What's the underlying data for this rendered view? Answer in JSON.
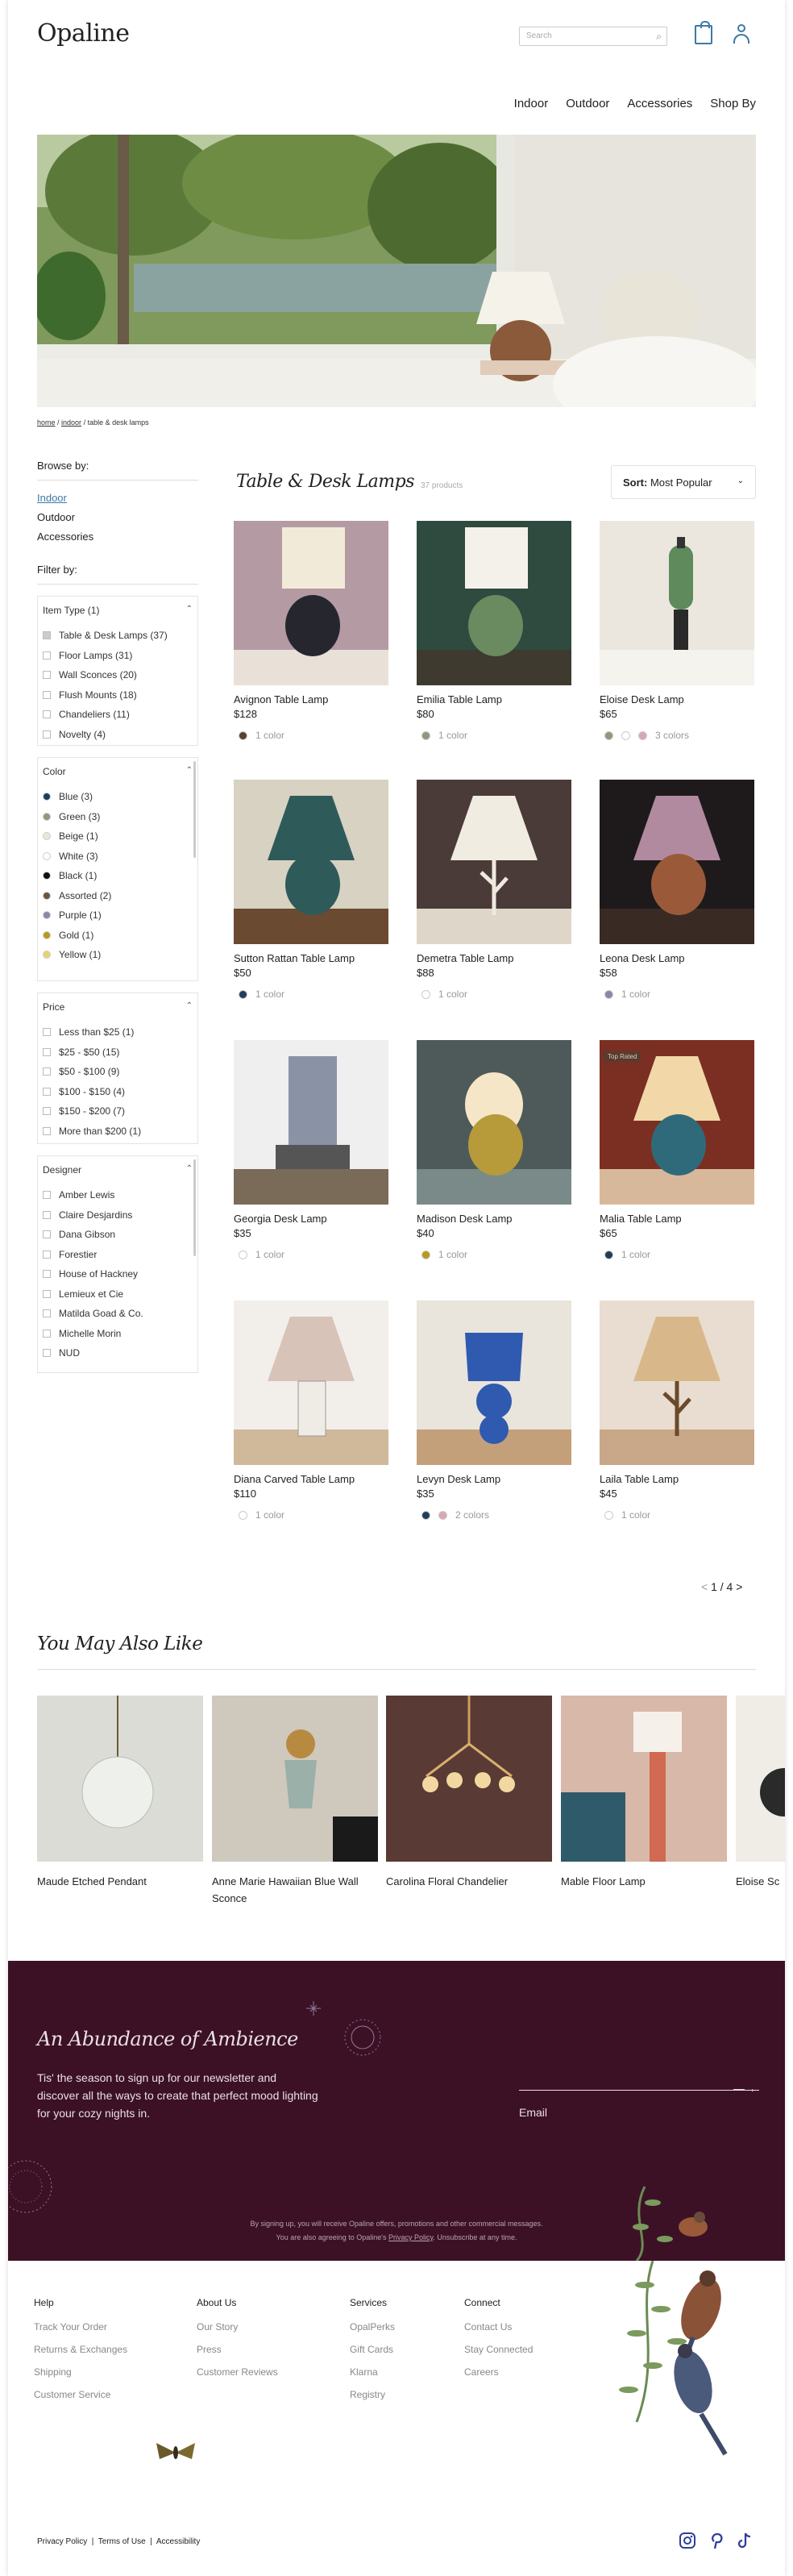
{
  "header": {
    "logo": "Opaline",
    "search_placeholder": "Search",
    "nav": [
      "Indoor",
      "Outdoor",
      "Accessories",
      "Shop By"
    ]
  },
  "breadcrumb": {
    "home": "home",
    "indoor": "indoor",
    "current": "table & desk lamps"
  },
  "sidebar": {
    "browse_heading": "Browse by:",
    "browse": [
      "Indoor",
      "Outdoor",
      "Accessories"
    ],
    "filter_heading": "Filter by:",
    "item_type": {
      "title": "Item Type (1)",
      "options": [
        "Table & Desk Lamps (37)",
        "Floor Lamps (31)",
        "Wall Sconces (20)",
        "Flush Mounts (18)",
        "Chandeliers (11)",
        "Novelty (4)"
      ]
    },
    "color": {
      "title": "Color",
      "options": [
        {
          "label": "Blue (3)",
          "color": "#1f3e5a"
        },
        {
          "label": "Green (3)",
          "color": "#8a9a7a"
        },
        {
          "label": "Beige (1)",
          "color": "#ece6d8"
        },
        {
          "label": "White (3)",
          "color": "#ffffff"
        },
        {
          "label": "Black (1)",
          "color": "#111111"
        },
        {
          "label": "Assorted (2)",
          "color": "#6b5440"
        },
        {
          "label": "Purple (1)",
          "color": "#8e86a8"
        },
        {
          "label": "Gold (1)",
          "color": "#b79a1a"
        },
        {
          "label": "Yellow (1)",
          "color": "#e7d36a"
        }
      ]
    },
    "price": {
      "title": "Price",
      "options": [
        "Less than $25 (1)",
        "$25 - $50 (15)",
        "$50 - $100 (9)",
        "$100 - $150 (4)",
        "$150 - $200 (7)",
        "More than $200 (1)"
      ]
    },
    "designer": {
      "title": "Designer",
      "options": [
        "Amber Lewis",
        "Claire Desjardins",
        "Dana Gibson",
        "Forestier",
        "House of Hackney",
        "Lemieux et Cie",
        "Matilda Goad & Co.",
        "Michelle Morin",
        "NUD"
      ]
    }
  },
  "catalog": {
    "title": "Table & Desk Lamps",
    "count": "37 products",
    "sort_label": "Sort:",
    "sort_value": "Most Popular",
    "pager": "1 / 4",
    "products": [
      {
        "name": "Avignon Table Lamp",
        "price": "$128",
        "colors_label": "1 color",
        "swatches": [
          "#5a4030"
        ]
      },
      {
        "name": "Emilia Table Lamp",
        "price": "$80",
        "colors_label": "1 color",
        "swatches": [
          "#8a9a7a"
        ]
      },
      {
        "name": "Eloise Desk Lamp",
        "price": "$65",
        "colors_label": "3 colors",
        "swatches": [
          "#8a9a7a",
          "#ffffff",
          "#d8a8b0"
        ]
      },
      {
        "name": "Sutton Rattan Table Lamp",
        "price": "$50",
        "colors_label": "1 color",
        "swatches": [
          "#1f3e5a"
        ]
      },
      {
        "name": "Demetra Table Lamp",
        "price": "$88",
        "colors_label": "1 color",
        "swatches": [
          "#ffffff"
        ]
      },
      {
        "name": "Leona Desk Lamp",
        "price": "$58",
        "colors_label": "1 color",
        "swatches": [
          "#8e86a8"
        ]
      },
      {
        "name": "Georgia Desk Lamp",
        "price": "$35",
        "colors_label": "1 color",
        "swatches": [
          "#ffffff"
        ]
      },
      {
        "name": "Madison Desk Lamp",
        "price": "$40",
        "colors_label": "1 color",
        "swatches": [
          "#b79a1a"
        ]
      },
      {
        "name": "Malia Table Lamp",
        "price": "$65",
        "colors_label": "1 color",
        "swatches": [
          "#1f3e5a"
        ],
        "badge": "Top Rated"
      },
      {
        "name": "Diana Carved Table Lamp",
        "price": "$110",
        "colors_label": "1 color",
        "swatches": [
          "#ffffff"
        ]
      },
      {
        "name": "Levyn Desk Lamp",
        "price": "$35",
        "colors_label": "2 colors",
        "swatches": [
          "#1f3e5a",
          "#d8a8b0"
        ]
      },
      {
        "name": "Laila Table Lamp",
        "price": "$45",
        "colors_label": "1 color",
        "swatches": [
          "#ffffff"
        ]
      }
    ]
  },
  "recommend": {
    "title": "You May Also Like",
    "items": [
      "Maude Etched Pendant",
      "Anne Marie Hawaiian Blue Wall Sconce",
      "Carolina Floral Chandelier",
      "Mable Floor Lamp",
      "Eloise Sc"
    ]
  },
  "newsletter": {
    "title": "An Abundance of Ambience",
    "body": "Tis' the season to sign up for our newsletter and discover all the ways to create that perfect mood lighting for your cozy nights in.",
    "arrow": "—→",
    "email_label": "Email",
    "fine1": "By signing up, you will receive Opaline offers, promotions and other commercial messages.",
    "fine2_pre": "You are also agreeing to Opaline's",
    "fine2_link": "Privacy Policy",
    "fine2_post": ". Unsubscribe at any time."
  },
  "footer": {
    "cols": [
      {
        "h": "Help",
        "links": [
          "Track Your Order",
          "Returns & Exchanges",
          "Shipping",
          "Customer Service"
        ]
      },
      {
        "h": "About Us",
        "links": [
          "Our Story",
          "Press",
          "Customer Reviews"
        ]
      },
      {
        "h": "Services",
        "links": [
          "OpalPerks",
          "Gift Cards",
          "Klarna",
          "Registry"
        ]
      },
      {
        "h": "Connect",
        "links": [
          "Contact Us",
          "Stay Connected",
          "Careers"
        ]
      }
    ],
    "legal": [
      "Privacy Policy",
      "Terms of Use",
      "Accessibility"
    ],
    "social": [
      "instagram-icon",
      "pinterest-icon",
      "tiktok-icon"
    ]
  }
}
